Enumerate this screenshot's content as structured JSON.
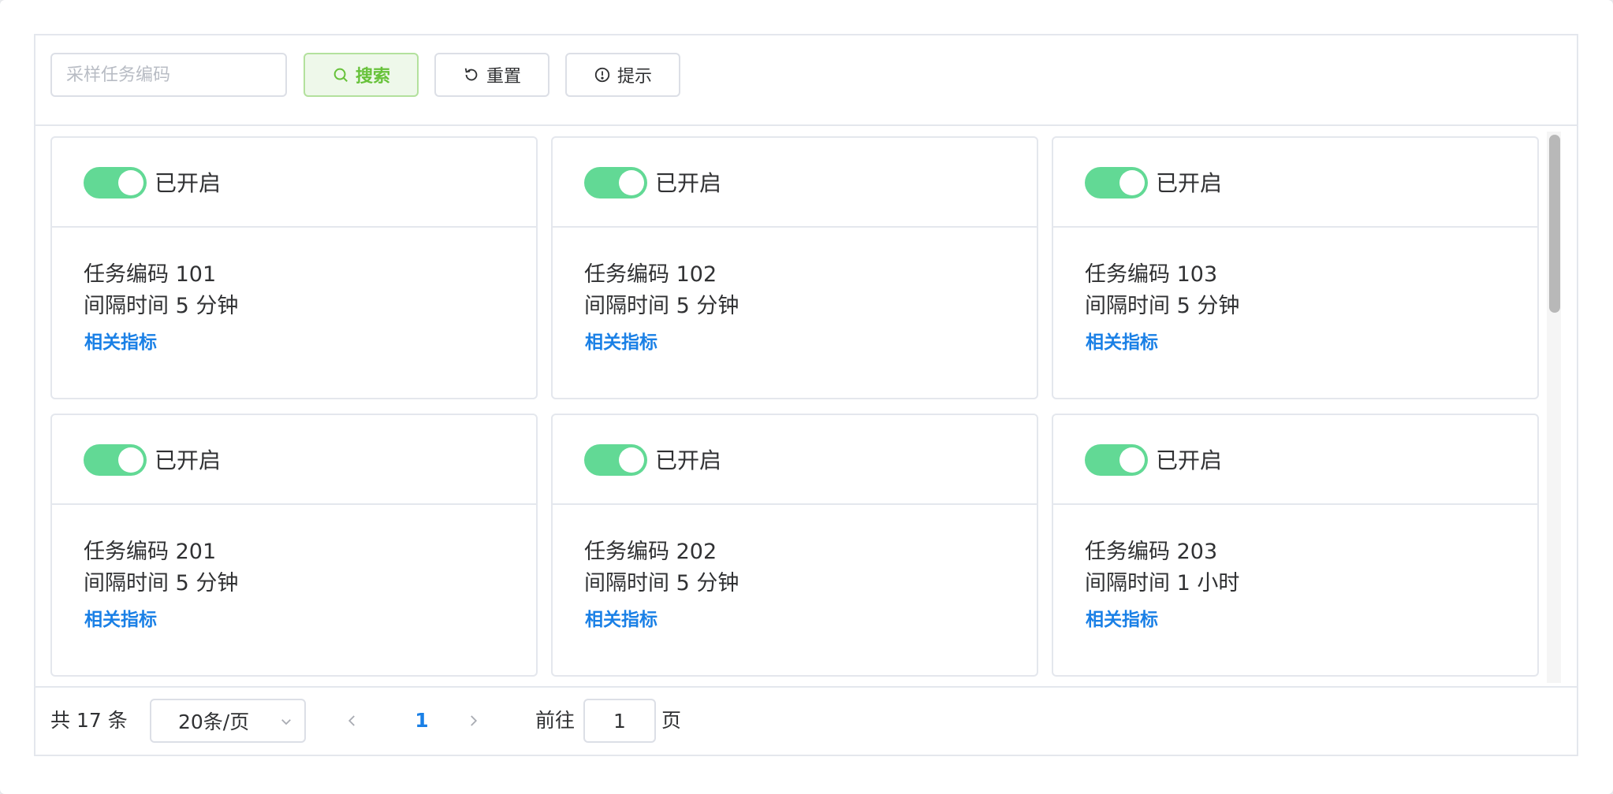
{
  "toolbar": {
    "search_placeholder": "采样任务编码",
    "search_value": "",
    "search_label": "搜索",
    "reset_label": "重置",
    "tips_label": "提示",
    "accent_color": "#67c23a"
  },
  "cards": [
    {
      "status": "已开启",
      "code": "任务编码 101",
      "interval": "间隔时间 5 分钟",
      "link": "相关指标",
      "enabled": true
    },
    {
      "status": "已开启",
      "code": "任务编码 102",
      "interval": "间隔时间 5 分钟",
      "link": "相关指标",
      "enabled": true
    },
    {
      "status": "已开启",
      "code": "任务编码 103",
      "interval": "间隔时间 5 分钟",
      "link": "相关指标",
      "enabled": true
    },
    {
      "status": "已开启",
      "code": "任务编码 201",
      "interval": "间隔时间 5 分钟",
      "link": "相关指标",
      "enabled": true
    },
    {
      "status": "已开启",
      "code": "任务编码 202",
      "interval": "间隔时间 5 分钟",
      "link": "相关指标",
      "enabled": true
    },
    {
      "status": "已开启",
      "code": "任务编码 203",
      "interval": "间隔时间 1 小时",
      "link": "相关指标",
      "enabled": true
    }
  ],
  "switch_color": "#62d995",
  "link_color": "#1a80e6",
  "pagination": {
    "total_text": "共 17 条",
    "page_size": "20条/页",
    "current_page": "1",
    "goto_label": "前往",
    "goto_value": "1",
    "goto_suffix": "页"
  }
}
